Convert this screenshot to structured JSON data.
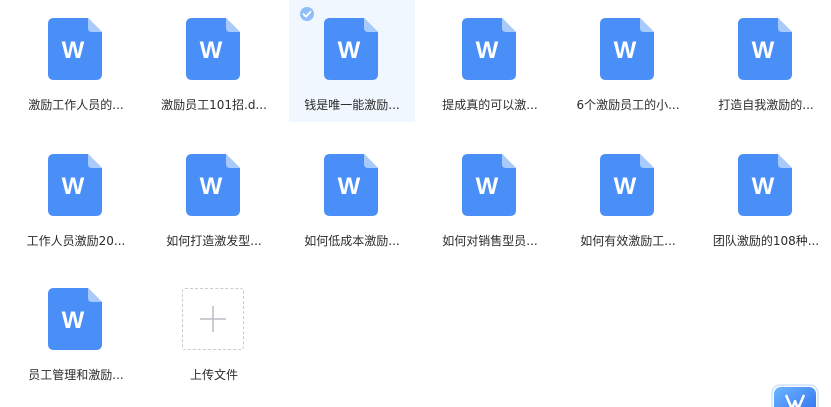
{
  "files": [
    {
      "name": "激励工作人员的...",
      "selected": false
    },
    {
      "name": "激励员工101招.d...",
      "selected": false
    },
    {
      "name": "钱是唯一能激励...",
      "selected": true
    },
    {
      "name": "提成真的可以激...",
      "selected": false
    },
    {
      "name": "6个激励员工的小...",
      "selected": false
    },
    {
      "name": "打造自我激励的...",
      "selected": false
    },
    {
      "name": "工作人员激励20...",
      "selected": false
    },
    {
      "name": "如何打造激发型...",
      "selected": false
    },
    {
      "name": "如何低成本激励...",
      "selected": false
    },
    {
      "name": "如何对销售型员...",
      "selected": false
    },
    {
      "name": "如何有效激励工...",
      "selected": false
    },
    {
      "name": "团队激励的108种...",
      "selected": false
    },
    {
      "name": "员工管理和激励...",
      "selected": false
    }
  ],
  "upload": {
    "label": "上传文件"
  },
  "icons": {
    "file": "word-document-icon",
    "letter": "W",
    "check": "check-circle-icon",
    "plus": "plus-icon"
  },
  "colors": {
    "file_blue": "#4a8ff7",
    "file_fold": "#a8cbfb",
    "selected_bg": "#f1f7fe",
    "check": "#8fbef8"
  }
}
